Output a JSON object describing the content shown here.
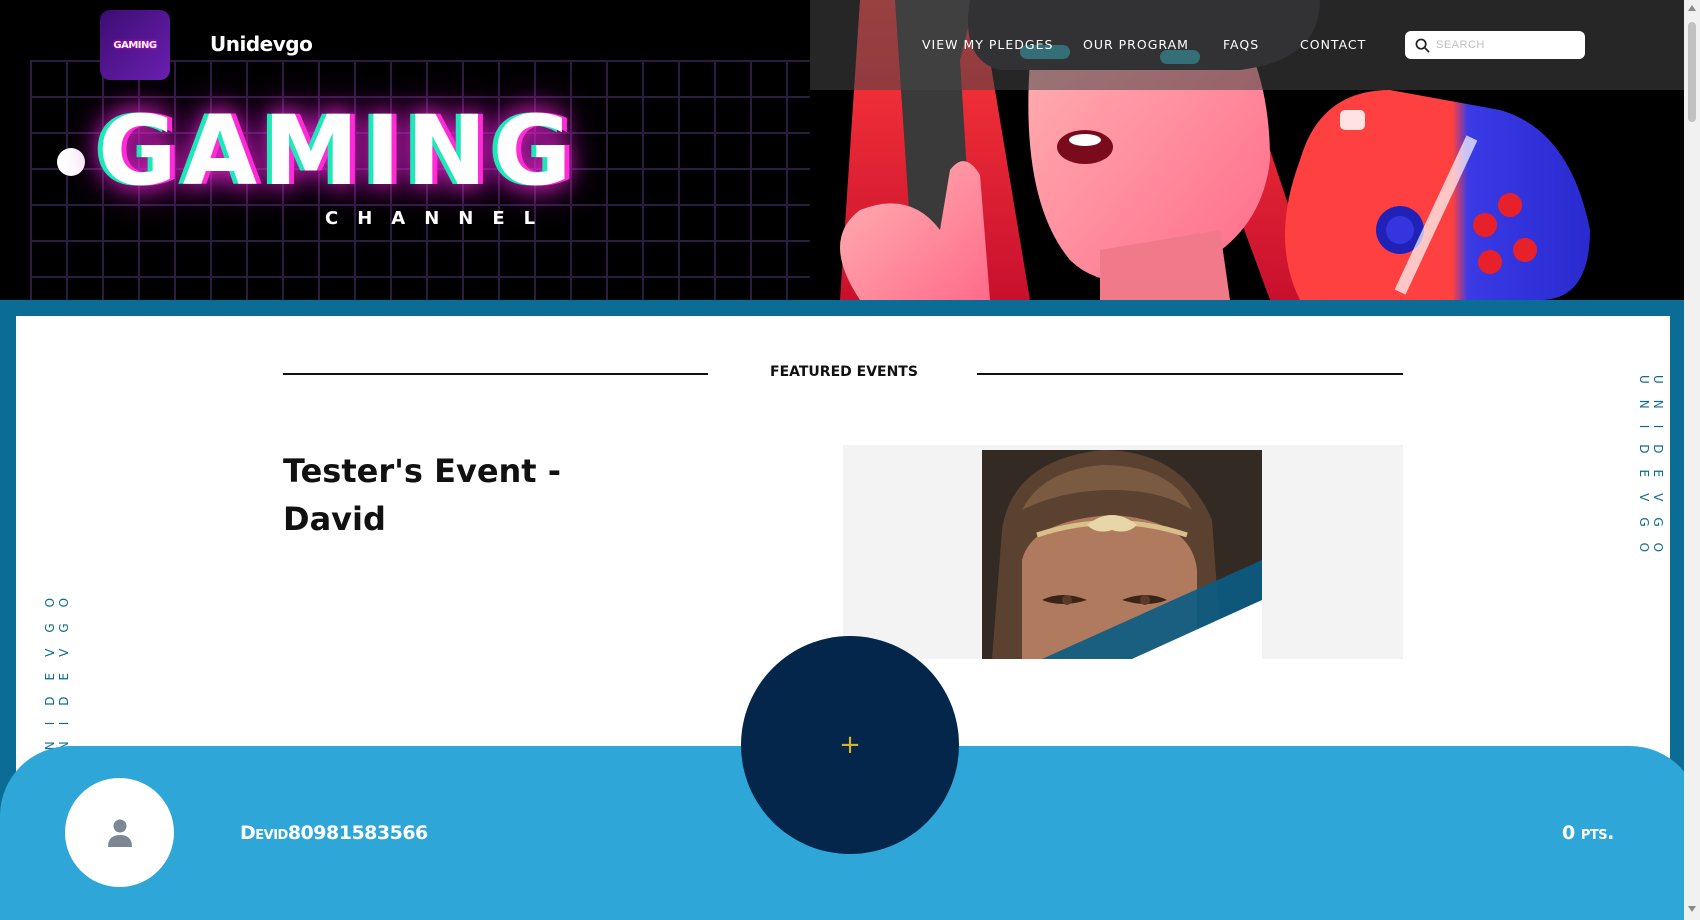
{
  "header": {
    "brand": "Unidevgo",
    "logo_badge_text": "GAMING",
    "nav": [
      {
        "label": "VIEW MY PLEDGES"
      },
      {
        "label": "OUR PROGRAM"
      },
      {
        "label": "FAQS"
      },
      {
        "label": "CONTACT"
      }
    ],
    "search": {
      "placeholder": "SEARCH",
      "value": "",
      "icon": "search-icon"
    }
  },
  "hero": {
    "title": "GAMING",
    "subtitle": "CHANNEL"
  },
  "sidebar_text": {
    "left": "UNIDEVGO UNIDEVGO",
    "right": "UNIDEVGO UNIDEVGO"
  },
  "featured": {
    "heading": "FEATURED EVENTS",
    "event_title": "Tester's Event - David"
  },
  "bottom_bar": {
    "username": "Devid80981583566",
    "points": "0 pts.",
    "add_button_label": "+",
    "avatar_icon": "user-icon"
  },
  "colors": {
    "hero_bg": "#000000",
    "content_bg": "#ffffff",
    "frame": "#0b6d95",
    "bottom_bar": "#2ea6d8",
    "fab": "#04264b",
    "fab_plus": "#d7b32a",
    "vertical_text": "#0e6b90"
  }
}
